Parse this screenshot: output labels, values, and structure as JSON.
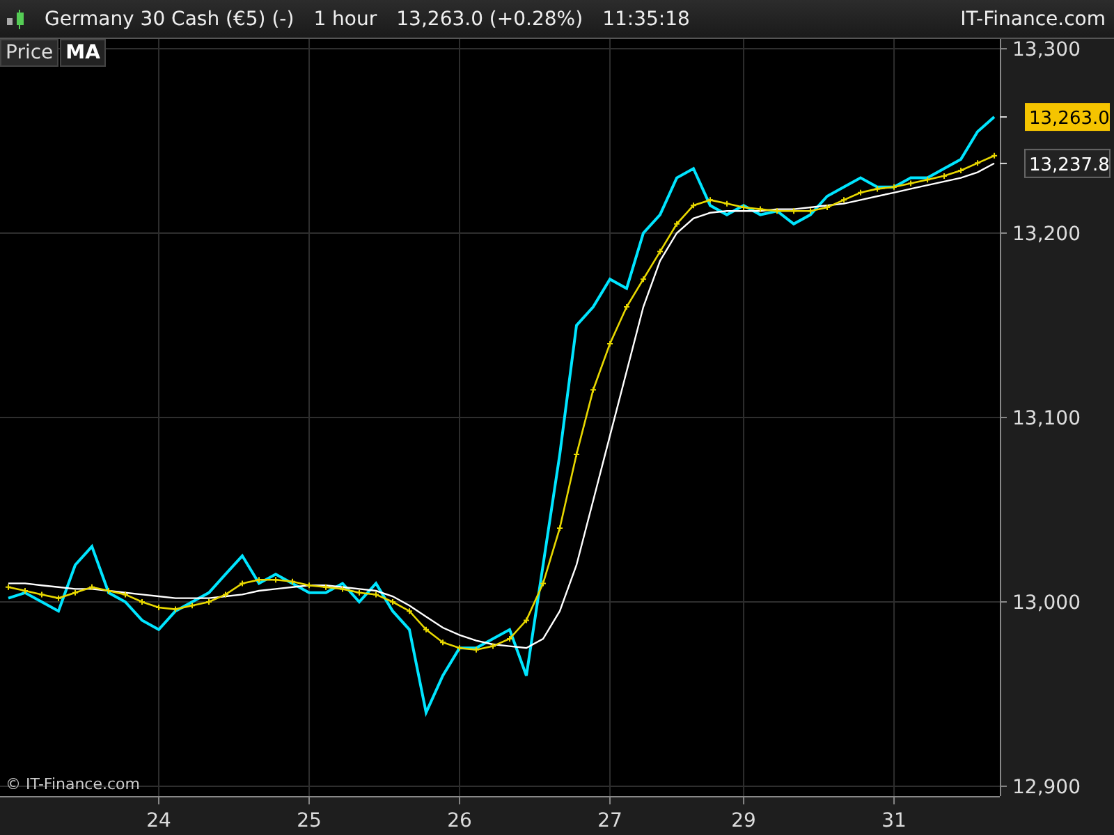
{
  "header": {
    "instrument": "Germany 30 Cash (€5) (-)",
    "timeframe": "1 hour",
    "quote": "13,263.0 (+0.28%)",
    "time": "11:35:18",
    "brand": "IT-Finance.com"
  },
  "legend": [
    {
      "label": "Price"
    },
    {
      "label": "MA"
    }
  ],
  "chart": {
    "watermark": "© IT-Finance.com",
    "last_price": "13,263.0",
    "ma_value": "13,237.8",
    "chart_data": {
      "type": "line",
      "categories": [
        null,
        null,
        null,
        null,
        null,
        null,
        null,
        null,
        null,
        "24",
        null,
        null,
        null,
        null,
        null,
        null,
        null,
        null,
        "25",
        null,
        null,
        null,
        null,
        null,
        null,
        null,
        null,
        "26",
        null,
        null,
        null,
        null,
        null,
        null,
        null,
        null,
        "27",
        null,
        null,
        null,
        null,
        null,
        null,
        null,
        "29",
        null,
        null,
        null,
        null,
        null,
        null,
        null,
        null,
        "31",
        null,
        null,
        null,
        null,
        null,
        null
      ],
      "series": [
        {
          "color": "#00e5ff",
          "values": [
            13002,
            13005,
            13000,
            12995,
            13020,
            13030,
            13005,
            13000,
            12990,
            12985,
            12995,
            13000,
            13005,
            13015,
            13025,
            13010,
            13015,
            13010,
            13005,
            13005,
            13010,
            13000,
            13010,
            12995,
            12985,
            12940,
            12960,
            12975,
            12975,
            12980,
            12985,
            12960,
            13020,
            13080,
            13150,
            13160,
            13175,
            13170,
            13200,
            13210,
            13230,
            13235,
            13215,
            13210,
            13215,
            13210,
            13212,
            13205,
            13210,
            13220,
            13225,
            13230,
            13225,
            13225,
            13230,
            13230,
            13235,
            13240,
            13255,
            13263
          ]
        },
        {
          "color": "#e8d800",
          "marker": "+",
          "values": [
            13008,
            13006,
            13004,
            13002,
            13005,
            13008,
            13006,
            13004,
            13000,
            12997,
            12996,
            12998,
            13000,
            13004,
            13010,
            13012,
            13012,
            13011,
            13009,
            13008,
            13007,
            13005,
            13004,
            13000,
            12995,
            12985,
            12978,
            12975,
            12974,
            12976,
            12980,
            12990,
            13010,
            13040,
            13080,
            13115,
            13140,
            13160,
            13175,
            13190,
            13205,
            13215,
            13218,
            13216,
            13214,
            13213,
            13212,
            13212,
            13212,
            13214,
            13218,
            13222,
            13224,
            13225,
            13227,
            13229,
            13231,
            13234,
            13238,
            13242
          ]
        },
        {
          "color": "#ffffff",
          "values": [
            13010,
            13010,
            13009,
            13008,
            13007,
            13007,
            13006,
            13005,
            13004,
            13003,
            13002,
            13002,
            13002,
            13003,
            13004,
            13006,
            13007,
            13008,
            13009,
            13009,
            13008,
            13007,
            13006,
            13003,
            12998,
            12992,
            12986,
            12982,
            12979,
            12977,
            12976,
            12975,
            12980,
            12995,
            13020,
            13055,
            13090,
            13125,
            13160,
            13185,
            13200,
            13208,
            13211,
            13212,
            13212,
            13212,
            13213,
            13213,
            13214,
            13215,
            13216,
            13218,
            13220,
            13222,
            13224,
            13226,
            13228,
            13230,
            13233,
            13237.8
          ]
        }
      ],
      "ylim": [
        12894.7,
        13305.3
      ],
      "grid": true,
      "yticks": [
        {
          "value": 12900,
          "label": "12,900"
        },
        {
          "value": 13000,
          "label": "13,000"
        },
        {
          "value": 13100,
          "label": "13,100"
        },
        {
          "value": 13200,
          "label": "13,200"
        },
        {
          "value": 13300,
          "label": "13,300"
        }
      ]
    }
  }
}
